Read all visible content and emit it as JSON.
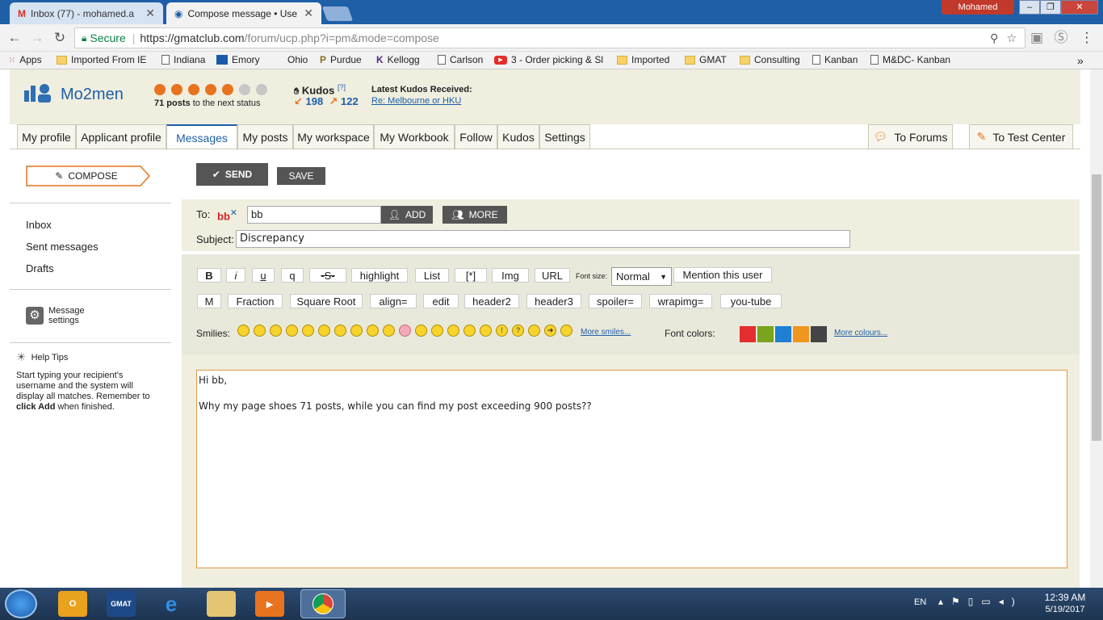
{
  "browser": {
    "tabs": [
      {
        "title": "Inbox (77) - mohamed.a",
        "icon": "gmail-icon"
      },
      {
        "title": "Compose message • Use",
        "icon": "gmatclub-icon"
      }
    ],
    "user": "Mohamed",
    "secure_label": "Secure",
    "url_base": "https://gmatclub.com",
    "url_path": "/forum/ucp.php?i=pm&mode=compose",
    "bookmarks": [
      "Apps",
      "Imported From IE",
      "Indiana",
      "Emory",
      "Ohio",
      "Purdue",
      "Kellogg",
      "Carlson",
      "3 - Order picking & Sl",
      "Imported",
      "GMAT",
      "Consulting",
      "Kanban",
      "M&DC- Kanban"
    ]
  },
  "profile": {
    "username": "Mo2men",
    "posts_text": "71 posts",
    "posts_suffix": " to the next status",
    "kudos_label": "Kudos",
    "kudos_help": "[?]",
    "kudos_given": "198",
    "kudos_received": "122",
    "latest_label": "Latest Kudos Received:",
    "latest_link": "Re: Melbourne or HKU",
    "status_dots": {
      "filled": 5,
      "total": 7
    }
  },
  "nav": {
    "tabs": [
      "My profile",
      "Applicant profile",
      "Messages",
      "My posts",
      "My workspace",
      "My Workbook",
      "Follow",
      "Kudos",
      "Settings"
    ],
    "to_forums": "To Forums",
    "to_test": "To Test Center"
  },
  "sidebar": {
    "compose": "COMPOSE",
    "inbox": "Inbox",
    "sent": "Sent messages",
    "drafts": "Drafts",
    "msg_settings_1": "Message",
    "msg_settings_2": "settings",
    "help_title": "Help Tips",
    "help_text": "Start typing your recipient's username and the system will display all matches. Remember to",
    "help_bold": "click Add",
    "help_tail": " when finished."
  },
  "compose": {
    "send": "SEND",
    "save": "SAVE",
    "to_label": "To:",
    "recipient": "bb",
    "to_value": "bb",
    "add": "ADD",
    "more": "MORE",
    "subject_label": "Subject:",
    "subject_value": "Discrepancy",
    "toolbar_row1": [
      "B",
      "i",
      "u",
      "q",
      "-S-",
      "highlight",
      "List",
      "[*]",
      "Img",
      "URL"
    ],
    "font_size_label": "Font size:",
    "font_size_value": "Normal",
    "mention": "Mention this user",
    "toolbar_row2": [
      "M",
      "Fraction",
      "Square Root",
      "align=",
      "edit",
      "header2",
      "header3",
      "spoiler=",
      "wrapimg=",
      "you-tube"
    ],
    "smilies_label": "Smilies:",
    "more_smilies": "More smiles...",
    "font_colors_label": "Font colors:",
    "more_colours": "More colours...",
    "colors": [
      "#e42d2d",
      "#7aa31e",
      "#1e7fd4",
      "#f0961e",
      "#444444"
    ],
    "message_line1": "Hi bb,",
    "message_line2": "Why my page shoes 71 posts, while you can find my post exceeding 900 posts??"
  },
  "taskbar": {
    "lang": "EN",
    "time": "12:39 AM",
    "date": "5/19/2017"
  }
}
